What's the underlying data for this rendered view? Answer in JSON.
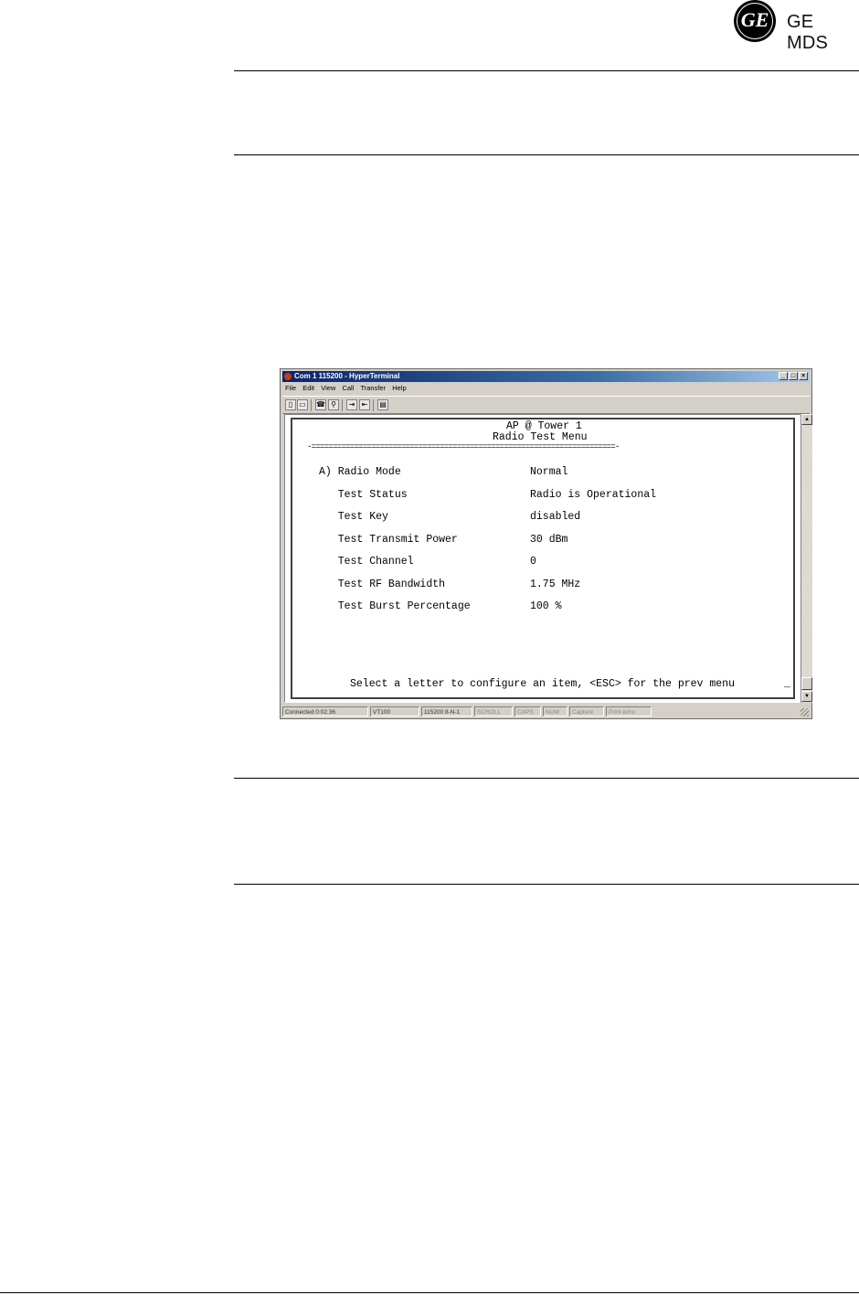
{
  "brand": {
    "monogram": "GE",
    "name": "GE MDS"
  },
  "terminal_window": {
    "title": "Com 1 115200 - HyperTerminal",
    "controls": [
      "_",
      "□",
      "×"
    ],
    "menu": [
      "File",
      "Edit",
      "View",
      "Call",
      "Transfer",
      "Help"
    ],
    "toolbar_icons": [
      "new-icon",
      "open-icon",
      "call-icon",
      "properties-icon",
      "send-icon",
      "receive-icon",
      "config-icon"
    ],
    "screen": {
      "header_line1": "AP @ Tower 1",
      "header_line2": "Radio Test Menu",
      "separator": "-=======================================================================-",
      "rows": [
        {
          "key": "A) Radio Mode",
          "value": "Normal"
        },
        {
          "key": "   Test Status",
          "value": "Radio is Operational"
        },
        {
          "key": "   Test Key",
          "value": "disabled"
        },
        {
          "key": "   Test Transmit Power",
          "value": "30 dBm"
        },
        {
          "key": "   Test Channel",
          "value": "0"
        },
        {
          "key": "   Test RF Bandwidth",
          "value": "1.75 MHz"
        },
        {
          "key": "   Test Burst Percentage",
          "value": "100 %"
        }
      ],
      "prompt": "Select a letter to configure an item, <ESC> for the prev menu",
      "cursor": "_"
    },
    "statusbar": [
      "Connected 0:02:36",
      "VT100",
      "115200 8-N-1",
      "SCROLL",
      "CAPS",
      "NUM",
      "Capture",
      "Print echo"
    ]
  }
}
